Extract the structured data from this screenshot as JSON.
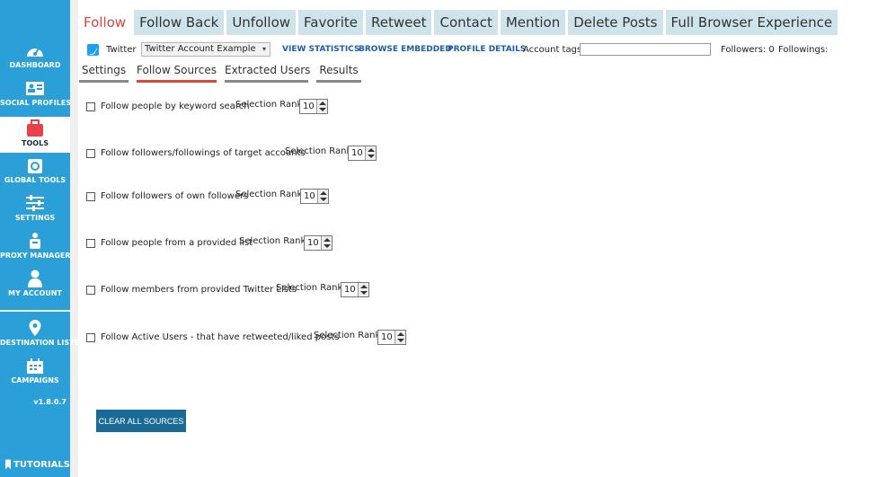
{
  "sidebar": {
    "items": [
      {
        "label": "DASHBOARD",
        "icon": "dashboard-icon"
      },
      {
        "label": "SOCIAL PROFILES",
        "icon": "social-profiles-icon"
      },
      {
        "label": "TOOLS",
        "icon": "tools-icon"
      },
      {
        "label": "GLOBAL TOOLS",
        "icon": "global-tools-icon"
      },
      {
        "label": "SETTINGS",
        "icon": "settings-icon"
      },
      {
        "label": "PROXY MANAGER",
        "icon": "proxy-manager-icon"
      },
      {
        "label": "MY ACCOUNT",
        "icon": "my-account-icon"
      },
      {
        "label": "DESTINATION LISTS",
        "icon": "destination-lists-icon"
      },
      {
        "label": "CAMPAIGNS",
        "icon": "campaigns-icon"
      }
    ],
    "version": "v1.8.0.7",
    "tutorials": "TUTORIALS",
    "accent": "#2a9fd8"
  },
  "top_tabs": [
    "Follow",
    "Follow Back",
    "Unfollow",
    "Favorite",
    "Retweet",
    "Contact",
    "Mention",
    "Delete Posts",
    "Full Browser Experience"
  ],
  "toolbar": {
    "network": "Twitter",
    "account": "Twitter Account Example",
    "view_statistics": "VIEW STATISTICS",
    "browse_embedded": "BROWSE EMBEDDED",
    "profile_details": "PROFILE DETAILS",
    "account_tags_label": "Account tags:",
    "account_tags_value": "",
    "followers": "Followers: 0",
    "followings": "Followings:"
  },
  "sub_tabs": [
    "Settings",
    "Follow Sources",
    "Extracted Users",
    "Results"
  ],
  "sources": [
    {
      "label": "Follow people by keyword search",
      "rank_label": "Selection Rank",
      "rank": "10"
    },
    {
      "label": "Follow followers/followings of target accounts",
      "rank_label": "Selection Rank",
      "rank": "10"
    },
    {
      "label": "Follow followers of own followers",
      "rank_label": "Selection Rank",
      "rank": "10"
    },
    {
      "label": "Follow people from a provided list",
      "rank_label": "Selection Rank",
      "rank": "10"
    },
    {
      "label": "Follow members from provided Twitter Lists",
      "rank_label": "Selection Rank",
      "rank": "10"
    },
    {
      "label": "Follow Active Users  - that have retweeted/liked posts",
      "rank_label": "Selection Rank",
      "rank": "10"
    }
  ],
  "clear_button": "CLEAR ALL SOURCES",
  "colors": {
    "active_tab_text": "#e0453a",
    "tab_bg": "#cfe3ea",
    "button": "#1a6a96",
    "link": "#1a5fa8"
  }
}
